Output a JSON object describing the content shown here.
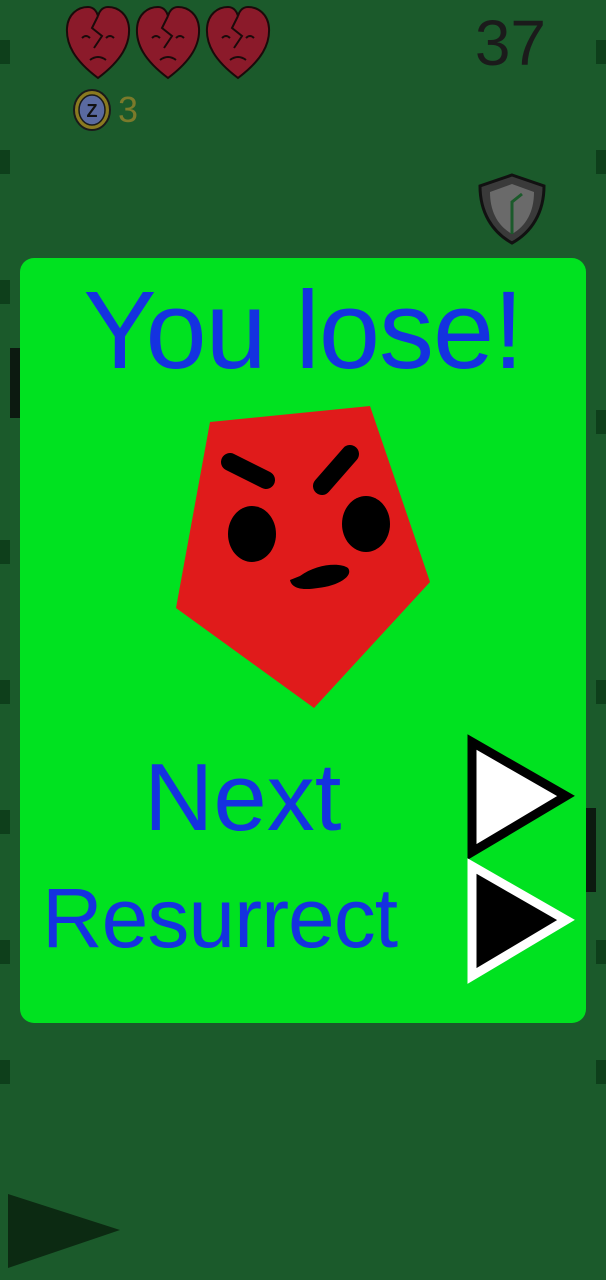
{
  "hud": {
    "lives": [
      {
        "icon": "broken-heart-icon"
      },
      {
        "icon": "broken-heart-icon"
      },
      {
        "icon": "broken-heart-icon"
      }
    ],
    "coin_letter": "Z",
    "coin_count": "3",
    "score": "37"
  },
  "dialog": {
    "title": "You lose!",
    "next_label": "Next",
    "resurrect_label": "Resurrect"
  },
  "colors": {
    "background": "#1b5a2b",
    "panel": "#00e220",
    "text": "#1432e0",
    "enemy": "#e01b1b",
    "heart": "#8b1a2a"
  }
}
